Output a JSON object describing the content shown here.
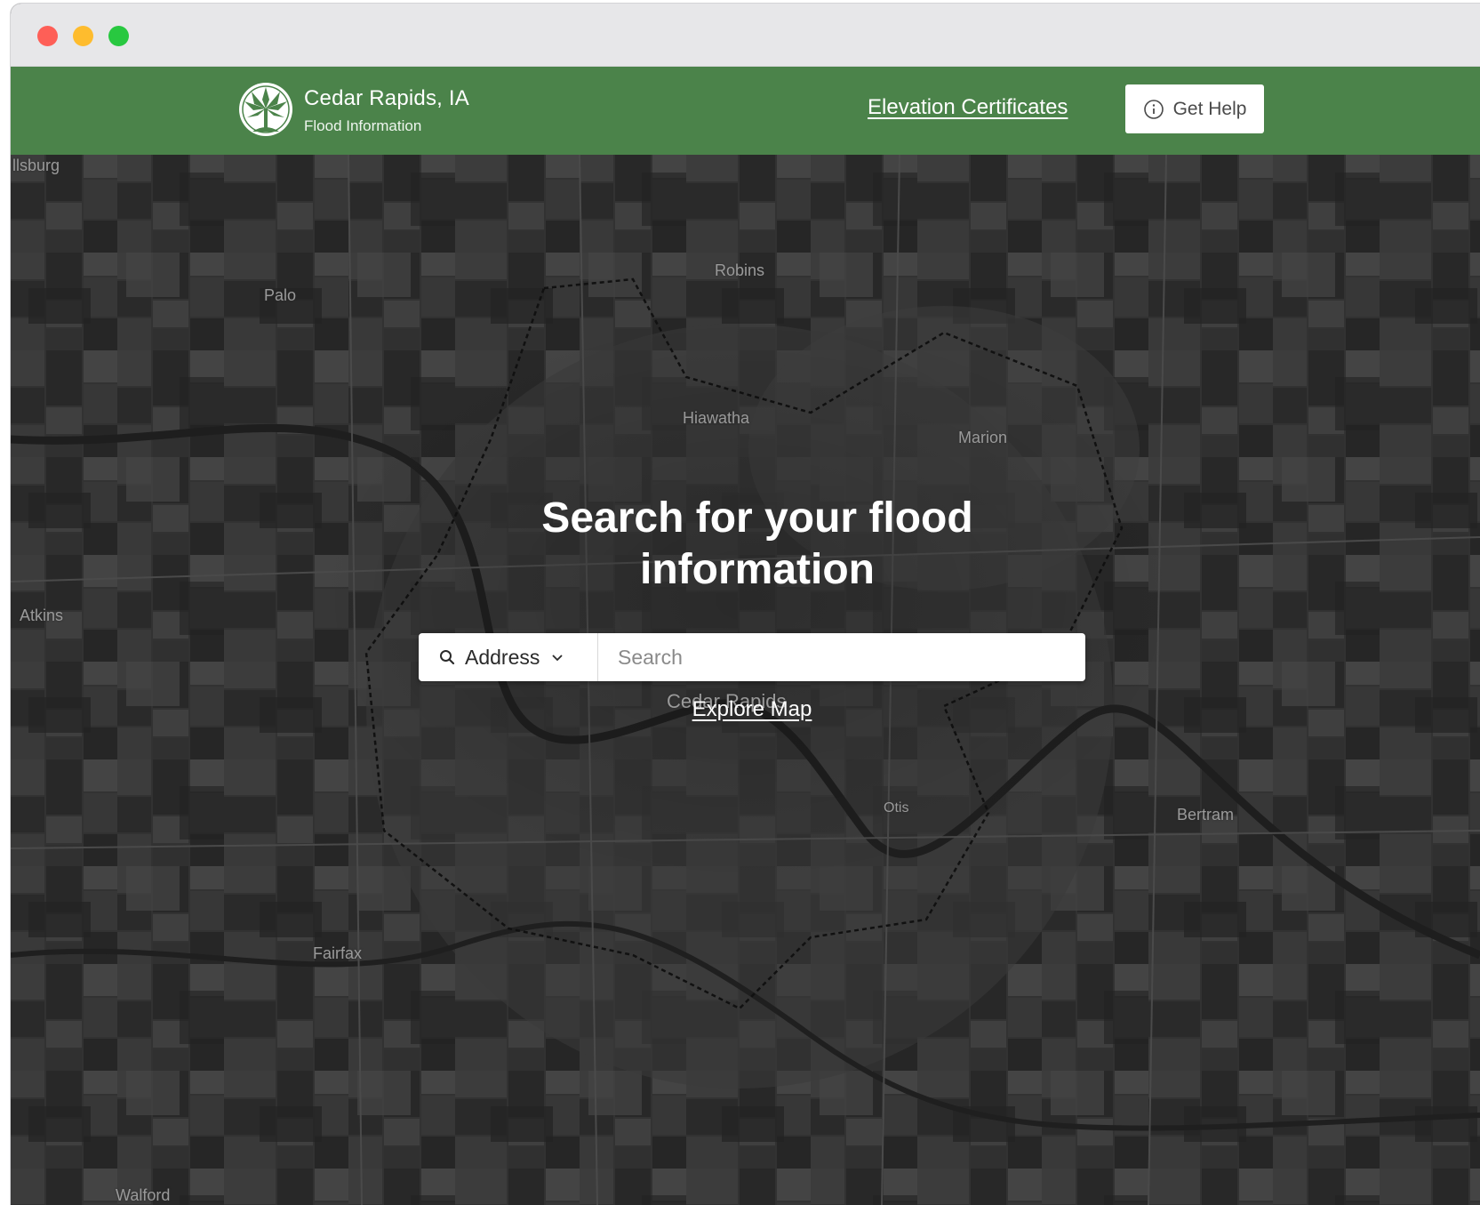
{
  "window": {
    "controls": [
      "close",
      "minimize",
      "zoom"
    ]
  },
  "header": {
    "logo_icon": "tree-logo-icon",
    "title": "Cedar Rapids, IA",
    "subtitle": "Flood Information",
    "nav_link": "Elevation Certificates",
    "help_button": "Get Help",
    "help_icon": "info-circle-icon"
  },
  "hero": {
    "title": "Search for your flood information",
    "search_type_label": "Address",
    "search_type_icon": "search-icon",
    "search_placeholder": "Search",
    "explore_link": "Explore Map"
  },
  "map": {
    "labels": {
      "ellsburg": "llsburg",
      "robins": "Robins",
      "palo": "Palo",
      "hiawatha": "Hiawatha",
      "marion": "Marion",
      "atkins": "Atkins",
      "cedar_rapids": "Cedar Rapids",
      "otis": "Otis",
      "bertram": "Bertram",
      "fairfax": "Fairfax",
      "walford": "Walford"
    }
  },
  "colors": {
    "header_green": "#4b834a",
    "map_base": "#2f2f2f",
    "text_white": "#ffffff"
  }
}
